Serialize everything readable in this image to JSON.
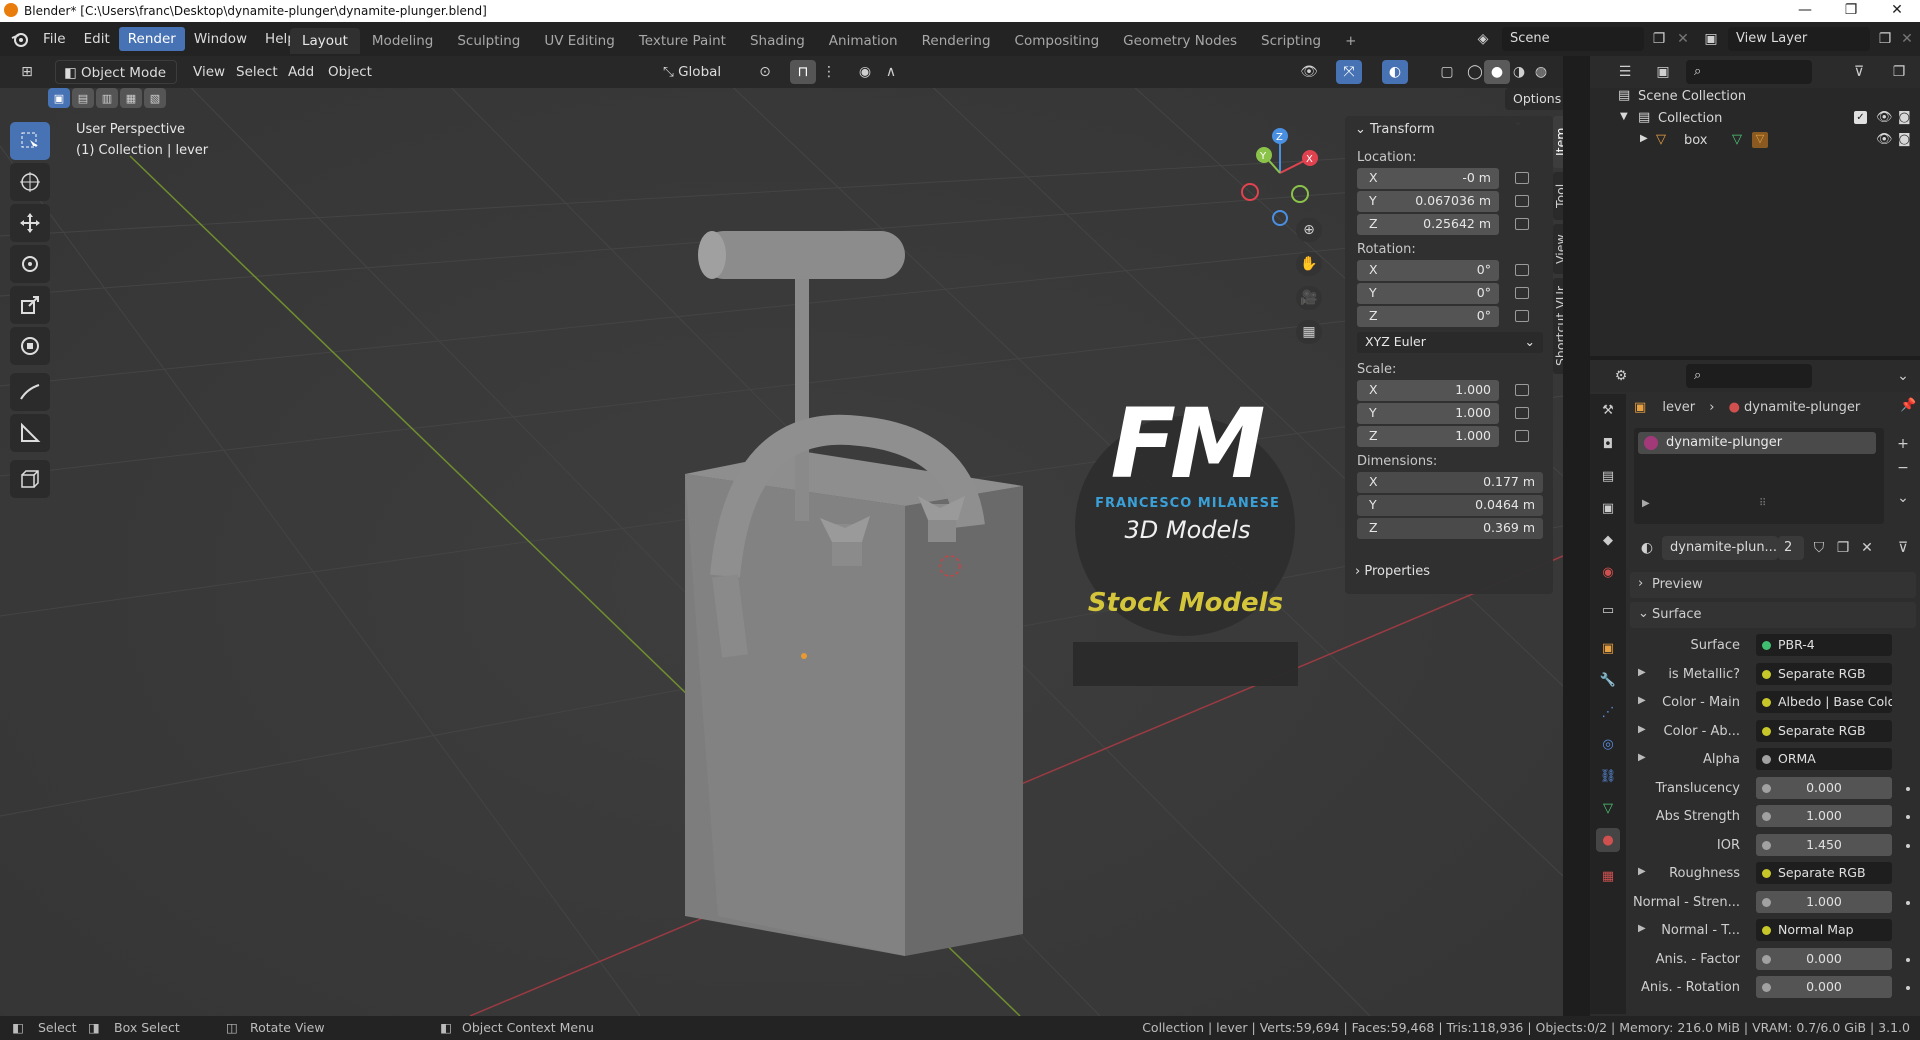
{
  "window": {
    "title": "Blender* [C:\\Users\\franc\\Desktop\\dynamite-plunger\\dynamite-plunger.blend]",
    "controls": [
      "—",
      "❐",
      "✕"
    ]
  },
  "menu": [
    "File",
    "Edit",
    "Render",
    "Window",
    "Help"
  ],
  "workspaces": [
    "Layout",
    "Modeling",
    "Sculpting",
    "UV Editing",
    "Texture Paint",
    "Shading",
    "Animation",
    "Rendering",
    "Compositing",
    "Geometry Nodes",
    "Scripting",
    "+"
  ],
  "scene": {
    "scene_name": "Scene",
    "view_layer": "View Layer"
  },
  "viewport_header": {
    "mode": "Object Mode",
    "menus": [
      "View",
      "Select",
      "Add",
      "Object"
    ],
    "orientation": "Global",
    "options_label": "Options"
  },
  "viewport": {
    "perspective_label": "User Perspective",
    "collection_label": "(1) Collection | lever",
    "gizmo_axes": [
      "Z",
      "Y",
      "X"
    ],
    "watermark": {
      "logo_text": "FM",
      "author": "FRANCESCO MILANESE",
      "subtitle": "3D Models",
      "banner": "Stock Models"
    }
  },
  "npanel": {
    "section_title": "Transform",
    "location_label": "Location:",
    "location": {
      "x": "-0 m",
      "y": "0.067036 m",
      "z": "0.25642 m"
    },
    "rotation_label": "Rotation:",
    "rotation": {
      "x": "0°",
      "y": "0°",
      "z": "0°"
    },
    "rotation_mode": "XYZ Euler",
    "scale_label": "Scale:",
    "scale": {
      "x": "1.000",
      "y": "1.000",
      "z": "1.000"
    },
    "dimensions_label": "Dimensions:",
    "dimensions": {
      "x": "0.177 m",
      "y": "0.0464 m",
      "z": "0.369 m"
    },
    "properties_label": "Properties",
    "axis_labels": [
      "X",
      "Y",
      "Z"
    ],
    "tabs": [
      "Item",
      "Tool",
      "View",
      "Shortcut VUr"
    ]
  },
  "outliner": {
    "items": [
      {
        "label": "Scene Collection"
      },
      {
        "label": "Collection"
      },
      {
        "label": "box"
      }
    ]
  },
  "properties": {
    "breadcrumb_object": "lever",
    "breadcrumb_material": "dynamite-plunger",
    "material_slot": "dynamite-plunger",
    "material_name": "dynamite-plun...",
    "user_count": "2",
    "preview_label": "Preview",
    "surface_section": "Surface",
    "rows": [
      {
        "label": "Surface",
        "value": "PBR-4",
        "socket": "#3fbf6f",
        "expand": false,
        "num": false,
        "dot": false
      },
      {
        "label": "is Metallic?",
        "value": "Separate RGB",
        "socket": "#c7c729",
        "expand": true,
        "num": false,
        "dot": false
      },
      {
        "label": "Color - Main",
        "value": "Albedo | Base Color",
        "socket": "#c7c729",
        "expand": true,
        "num": false,
        "dot": false
      },
      {
        "label": "Color - Ab...",
        "value": "Separate RGB",
        "socket": "#c7c729",
        "expand": true,
        "num": false,
        "dot": false
      },
      {
        "label": "Alpha",
        "value": "ORMA",
        "socket": "#a1a1a1",
        "expand": true,
        "num": false,
        "dot": false
      },
      {
        "label": "Translucency",
        "value": "0.000",
        "socket": "#a1a1a1",
        "expand": false,
        "num": true,
        "dot": true
      },
      {
        "label": "Abs Strength",
        "value": "1.000",
        "socket": "#a1a1a1",
        "expand": false,
        "num": true,
        "dot": true
      },
      {
        "label": "IOR",
        "value": "1.450",
        "socket": "#a1a1a1",
        "expand": false,
        "num": true,
        "dot": true
      },
      {
        "label": "Roughness",
        "value": "Separate RGB",
        "socket": "#c7c729",
        "expand": true,
        "num": false,
        "dot": false
      },
      {
        "label": "Normal - Stren...",
        "value": "1.000",
        "socket": "#a1a1a1",
        "expand": false,
        "num": true,
        "dot": true
      },
      {
        "label": "Normal - T...",
        "value": "Normal Map",
        "socket": "#c7c729",
        "expand": true,
        "num": false,
        "dot": false
      },
      {
        "label": "Anis. - Factor",
        "value": "0.000",
        "socket": "#a1a1a1",
        "expand": false,
        "num": true,
        "dot": true
      },
      {
        "label": "Anis. - Rotation",
        "value": "0.000",
        "socket": "#a1a1a1",
        "expand": false,
        "num": true,
        "dot": true
      }
    ]
  },
  "statusbar": {
    "select": "Select",
    "box_select": "Box Select",
    "rotate_view": "Rotate View",
    "context_menu": "Object Context Menu",
    "stats": "Collection | lever | Verts:59,694 | Faces:59,468 | Tris:118,936 | Objects:0/2 | Memory: 216.0 MiB | VRAM: 0.7/6.0 GiB | 3.1.0"
  },
  "colors": {
    "accent": "#4772b3",
    "axis_x": "#e0434f",
    "axis_y": "#8bc34a",
    "axis_z": "#4a90e2",
    "banner_text": "#d4c53a"
  }
}
